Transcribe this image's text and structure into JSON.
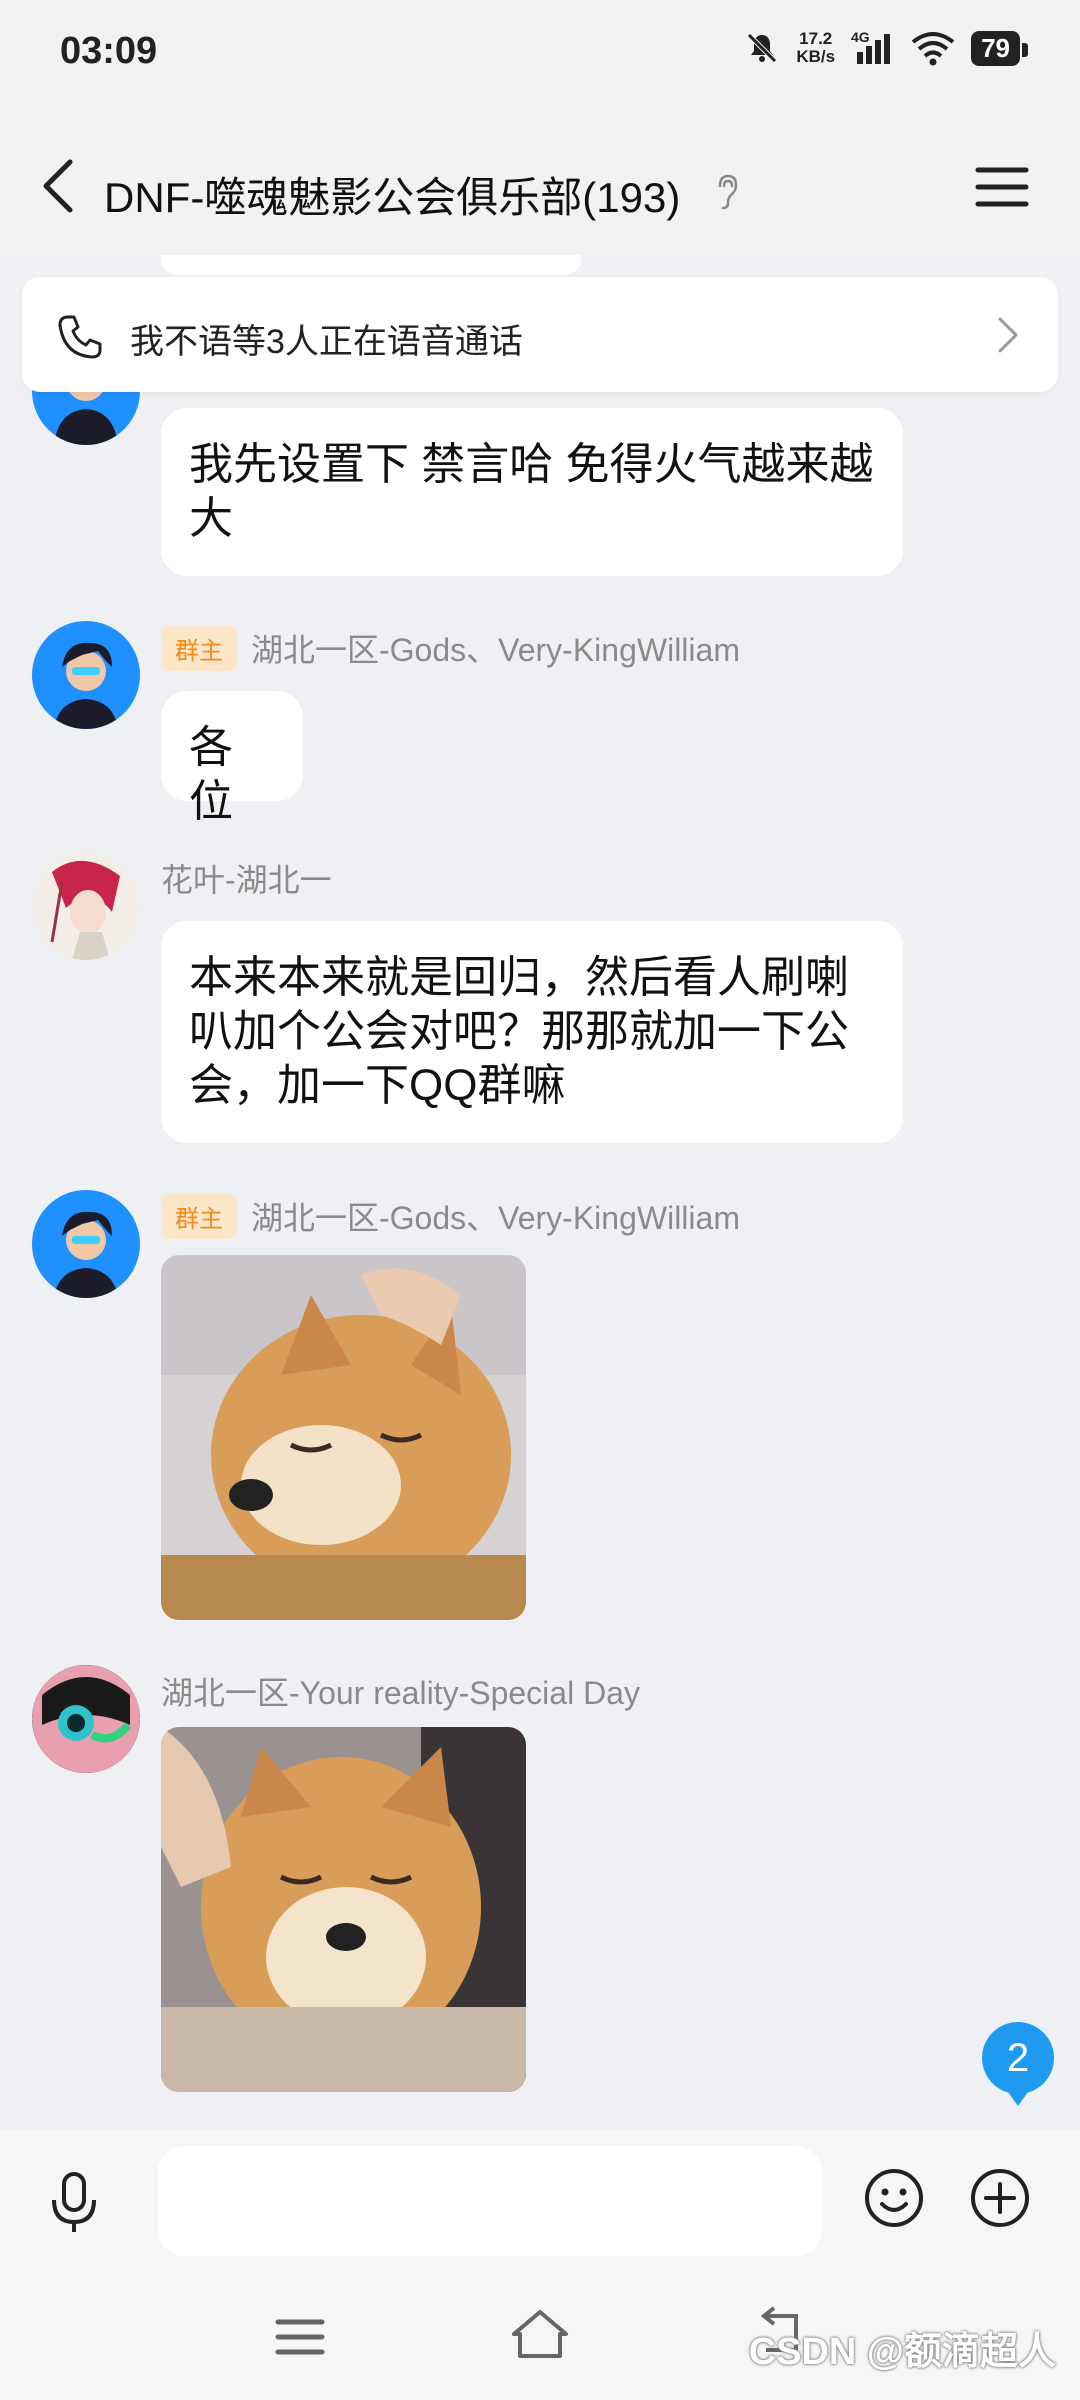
{
  "status_bar": {
    "time": "03:09",
    "net_speed_value": "17.2",
    "net_speed_unit": "KB/s",
    "network_type": "4G",
    "battery": "79"
  },
  "header": {
    "title": "DNF-噬魂魅影公会俱乐部(193)"
  },
  "call_banner": {
    "text": "我不语等3人正在语音通话"
  },
  "messages": [
    {
      "text": "我先设置下 禁言哈  免得火气越来越大"
    },
    {
      "badge": "群主",
      "sender": "湖北一区-Gods、Very-KingWilliam",
      "text": "各位"
    },
    {
      "sender": "花叶-湖北一",
      "text": "本来本来就是回归，然后看人刷喇叭加个公会对吧？那那就加一下公会，加一下QQ群嘛"
    },
    {
      "badge": "群主",
      "sender": "湖北一区-Gods、Very-KingWilliam",
      "image": "shiba-dog-sticker"
    },
    {
      "sender": "湖北一区-Your reality-Special Day",
      "image": "shiba-dog-sticker"
    }
  ],
  "unread_count": "2",
  "input": {
    "placeholder": ""
  },
  "watermark": "CSDN @额滴超人",
  "colors": {
    "accent": "#1e9bf0",
    "badge_bg": "#fde6c8",
    "badge_text": "#f28b1a"
  }
}
